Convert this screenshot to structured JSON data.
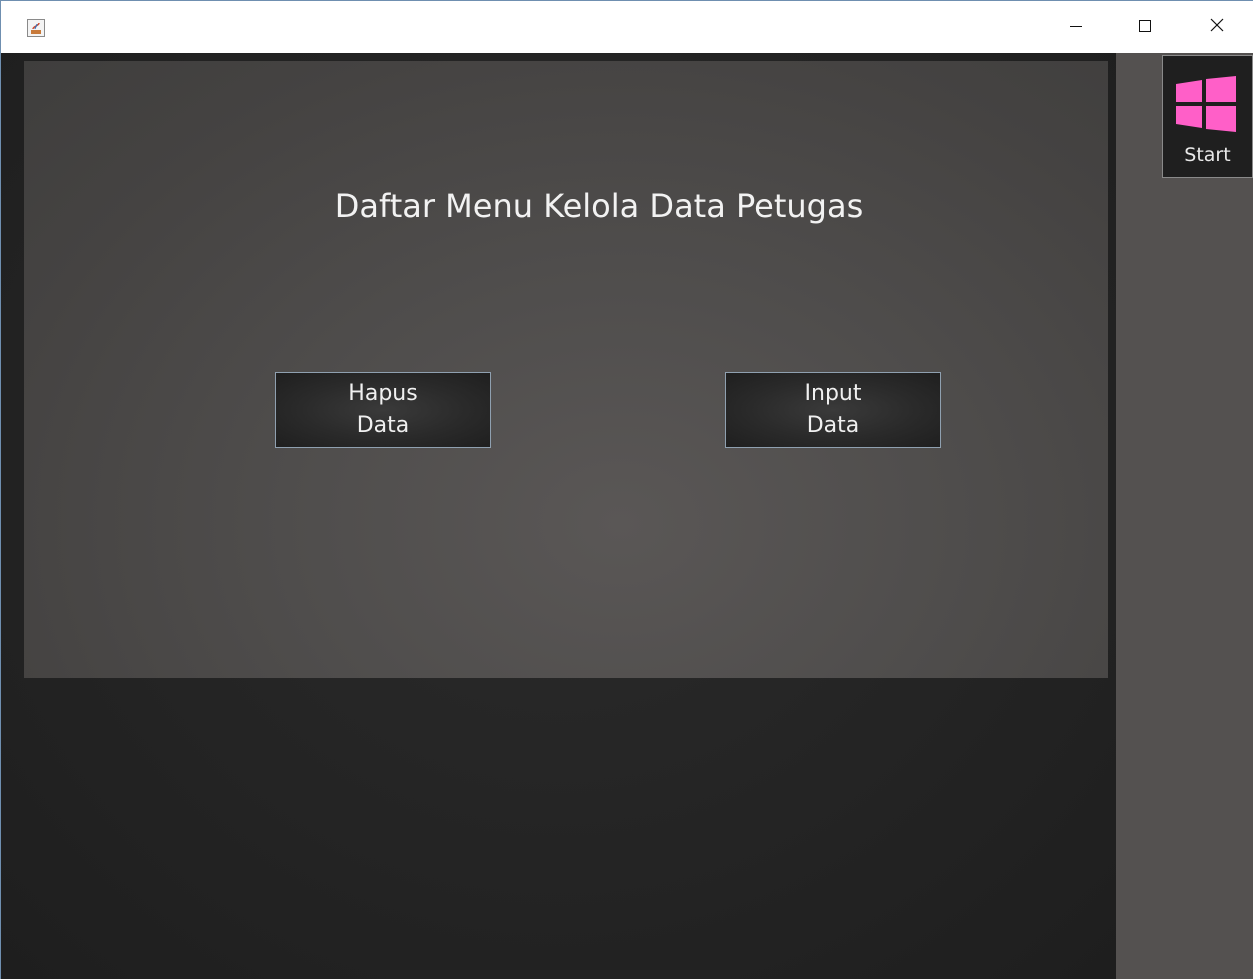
{
  "window": {
    "title": "",
    "controls": {
      "minimize_icon": "minimize-icon",
      "maximize_icon": "maximize-icon",
      "close_icon": "close-icon"
    },
    "app_icon": "java-app-icon"
  },
  "main": {
    "title": "Daftar Menu Kelola Data Petugas",
    "buttons": {
      "hapus": {
        "line1": "Hapus",
        "line2": "Data"
      },
      "input": {
        "line1": "Input",
        "line2": "Data"
      }
    }
  },
  "side": {
    "start_label": "Start",
    "start_icon": "windows-logo-icon",
    "start_color": "#ff5fc8"
  },
  "colors": {
    "panel_dark": "#1f1f1f",
    "panel_mid": "#4f4d4c",
    "text": "#f2f2f2",
    "accent_pink": "#ff5fc8"
  }
}
